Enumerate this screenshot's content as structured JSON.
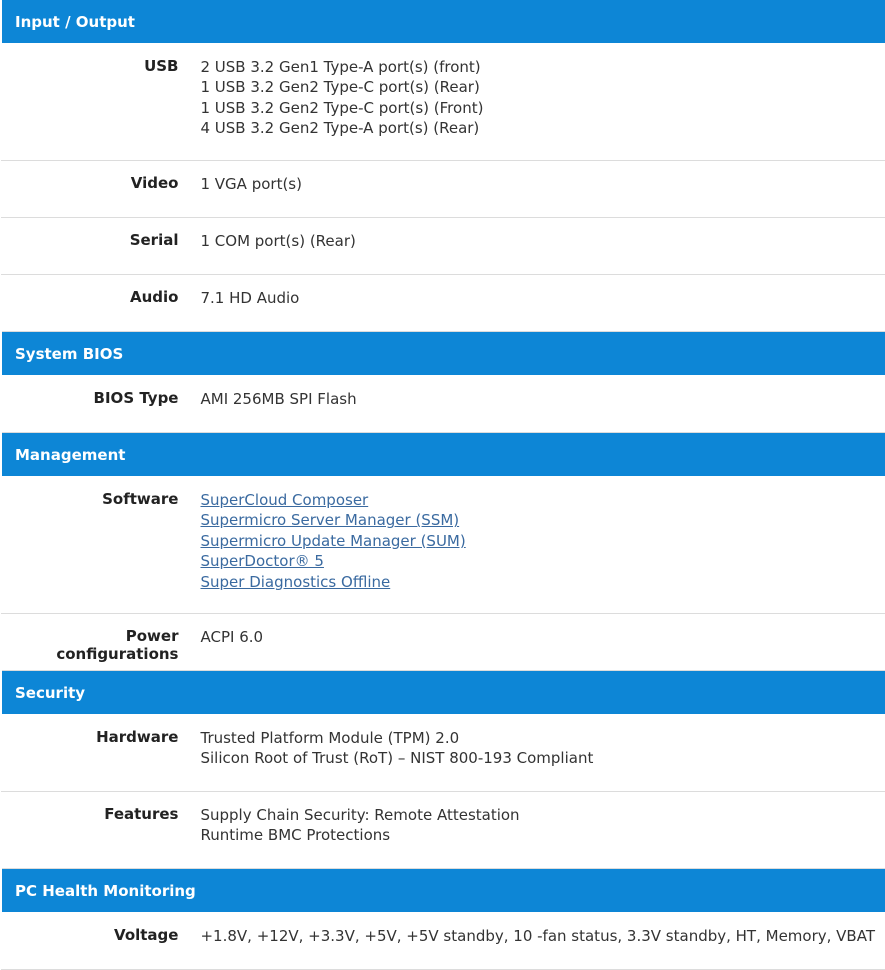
{
  "sections": {
    "io": {
      "title": "Input / Output",
      "usb": {
        "label": "USB",
        "lines": [
          "2 USB 3.2 Gen1 Type-A port(s) (front)",
          "1 USB 3.2 Gen2 Type-C port(s) (Rear)",
          "1 USB 3.2 Gen2 Type-C port(s) (Front)",
          "4 USB 3.2 Gen2 Type-A port(s) (Rear)"
        ]
      },
      "video": {
        "label": "Video",
        "value": "1 VGA port(s)"
      },
      "serial": {
        "label": "Serial",
        "value": "1 COM port(s) (Rear)"
      },
      "audio": {
        "label": "Audio",
        "value": "7.1 HD Audio"
      }
    },
    "bios": {
      "title": "System BIOS",
      "bios_type": {
        "label": "BIOS Type",
        "value": "AMI 256MB SPI Flash"
      }
    },
    "management": {
      "title": "Management",
      "software": {
        "label": "Software",
        "links": [
          "SuperCloud Composer",
          "Supermicro Server Manager (SSM)",
          "Supermicro Update Manager (SUM)",
          "SuperDoctor® 5",
          "Super Diagnostics Offline"
        ]
      },
      "power": {
        "label": "Power configurations",
        "value": "ACPI 6.0"
      }
    },
    "security": {
      "title": "Security",
      "hardware": {
        "label": "Hardware",
        "lines": [
          "Trusted Platform Module (TPM) 2.0",
          "Silicon Root of Trust (RoT) – NIST 800-193 Compliant"
        ]
      },
      "features": {
        "label": "Features",
        "lines": [
          "Supply Chain Security: Remote Attestation",
          "Runtime BMC Protections"
        ]
      }
    },
    "health": {
      "title": "PC Health Monitoring",
      "voltage": {
        "label": "Voltage",
        "value": "+1.8V, +12V, +3.3V, +5V, +5V standby, 10 -fan status, 3.3V standby, HT, Memory, VBAT"
      }
    }
  }
}
